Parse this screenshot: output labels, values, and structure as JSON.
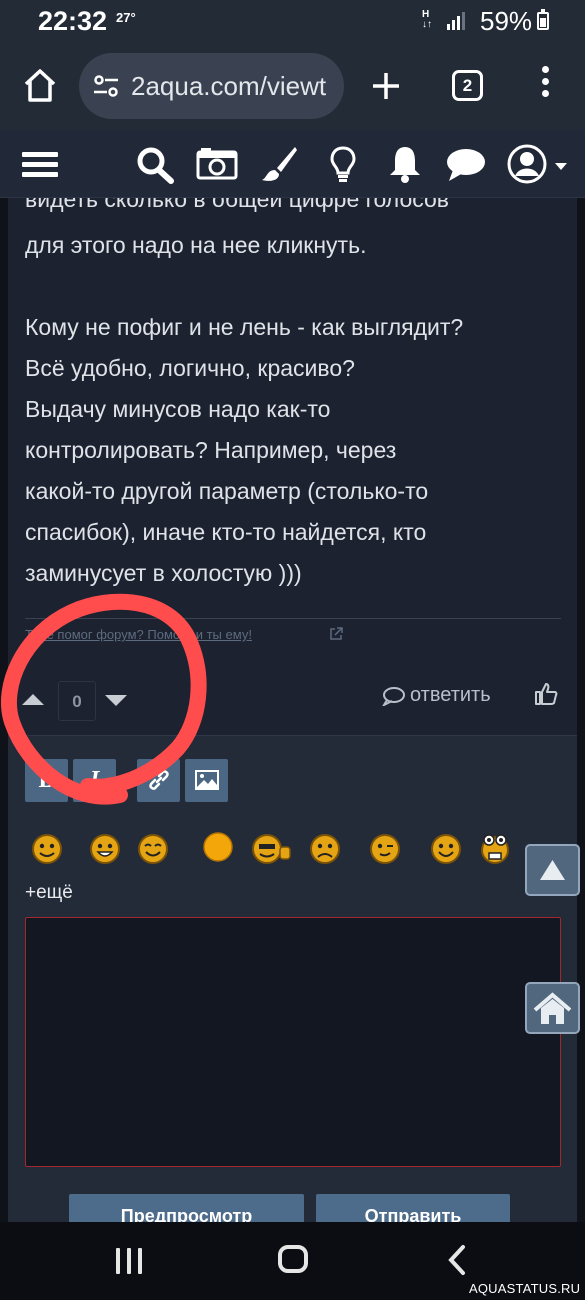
{
  "status_bar": {
    "time": "22:32",
    "temperature": "27°",
    "network": "H",
    "battery": "59%"
  },
  "browser": {
    "url": "2aqua.com/viewt",
    "tab_count": "2"
  },
  "post": {
    "cut_line": "видеть сколько в общей цифре голосов",
    "lines": [
      "для этого надо на нее кликнуть.",
      "",
      "Кому не пофиг и не лень - как выглядит?",
      "Всё удобно, логично, красиво?",
      "Выдачу минусов надо как-то",
      "контролировать? Например, через",
      "какой-то другой параметр (столько-то",
      "спасибок), иначе кто-то найдется, кто",
      "заминусует в холостую )))"
    ],
    "signature": "Тебе помог форум? Помоги и ты ему!"
  },
  "vote": {
    "count": "0"
  },
  "reply_label": "ответить",
  "form": {
    "formatting": {
      "bold": "B",
      "italic": "I"
    },
    "more_smilies": "+ещё",
    "textarea_value": "",
    "preview_label": "Предпросмотр",
    "submit_label": "Отправить"
  },
  "watermark": "AQUASTATUS.RU",
  "colors": {
    "background": "#1c2230",
    "toolbar": "#212838",
    "format_button": "#4b6784",
    "textarea_border": "#a1292b",
    "annotation": "#ff4d4d"
  },
  "icons": [
    "home-icon",
    "tune-icon",
    "plus-icon",
    "tabs-icon",
    "more-icon",
    "menu-icon",
    "search-icon",
    "camera-icon",
    "brush-icon",
    "lightbulb-icon",
    "bell-icon",
    "chat-icon",
    "user-icon",
    "thumbs-up-icon",
    "image-icon",
    "link-icon",
    "arrow-up-icon",
    "house-icon"
  ]
}
